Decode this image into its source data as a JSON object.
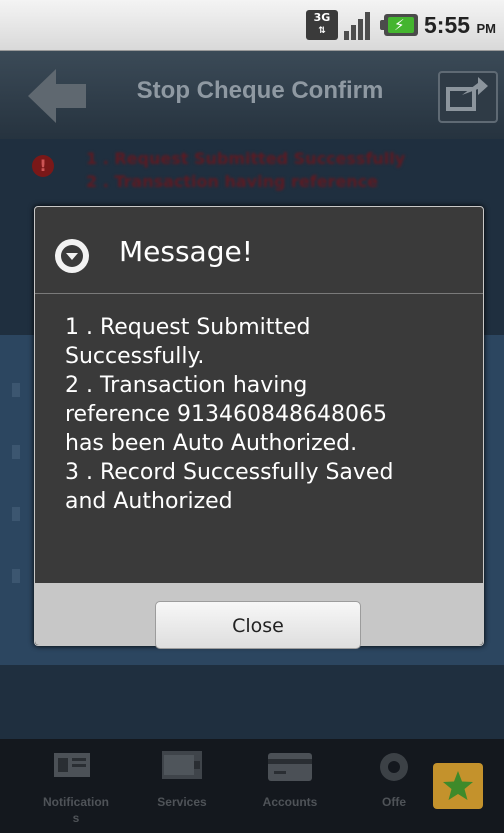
{
  "status_bar": {
    "network_type": "3G",
    "time": "5:55",
    "ampm": "PM",
    "icons": [
      "3g-icon",
      "signal-icon",
      "battery-charging-icon"
    ]
  },
  "header": {
    "title": "Stop Cheque Confirm",
    "back_icon": "back-arrow-icon",
    "share_icon": "share-icon"
  },
  "background_errors": [
    "1 . Request Submitted Successfully",
    "2 . Transaction having reference"
  ],
  "dialog": {
    "title": "Message!",
    "title_icon": "chevron-circle-icon",
    "message_lines": [
      "1 . Request Submitted",
      "Successfully.",
      "2 . Transaction having",
      "reference 913460848648065",
      "has been Auto Authorized.",
      "3 . Record Successfully Saved",
      "and Authorized"
    ],
    "close_label": "Close"
  },
  "bottom_nav": {
    "items": [
      {
        "label_line1": "Notification",
        "label_line2": "s",
        "icon": "notifications-icon"
      },
      {
        "label_line1": "Services",
        "label_line2": "",
        "icon": "services-icon"
      },
      {
        "label_line1": "Accounts",
        "label_line2": "",
        "icon": "accounts-icon"
      },
      {
        "label_line1": "Offe",
        "label_line2": "",
        "icon": "offers-icon"
      }
    ],
    "favorite_icon": "star-icon"
  },
  "colors": {
    "accent": "#c4922c",
    "error_text": "#5e1a22",
    "battery": "#44b52f"
  }
}
